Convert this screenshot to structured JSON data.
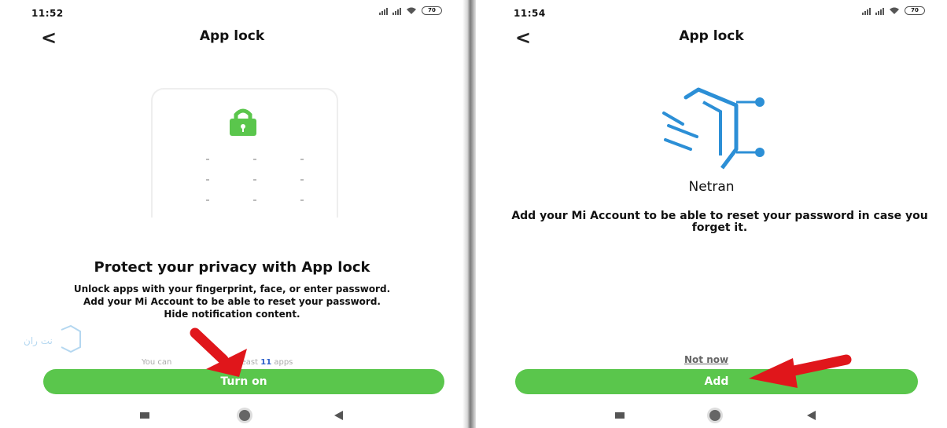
{
  "left_screen": {
    "status_time": "11:52",
    "battery": "70",
    "title": "App lock",
    "back_label": "<",
    "heading": "Protect your privacy with App lock",
    "description_lines": [
      "Unlock apps with your fingerprint, face, or enter password.",
      "Add your Mi Account to be able to reset your password.",
      "Hide notification content."
    ],
    "count_prefix": "You can",
    "count_middle": "t least",
    "count_value": "11",
    "count_suffix": "apps",
    "turn_on_label": "Turn on",
    "watermark_text": "نت ران"
  },
  "right_screen": {
    "status_time": "11:54",
    "battery": "70",
    "title": "App lock",
    "back_label": "<",
    "brand_name": "Netran",
    "add_account_text": "Add your Mi Account to be able to reset your password in case you forget it.",
    "not_now_label": "Not now",
    "add_label": "Add"
  },
  "colors": {
    "accent_green": "#5ac64c",
    "arrow_red": "#e0161b",
    "logo_blue": "#2c8fd6",
    "count_blue": "#2b5fc9"
  },
  "icons": [
    "lock-icon",
    "netran-logo-icon",
    "red-arrow-icon",
    "back-icon",
    "signal-icon",
    "wifi-icon",
    "battery-icon",
    "recents-icon",
    "home-icon",
    "back-nav-icon"
  ]
}
